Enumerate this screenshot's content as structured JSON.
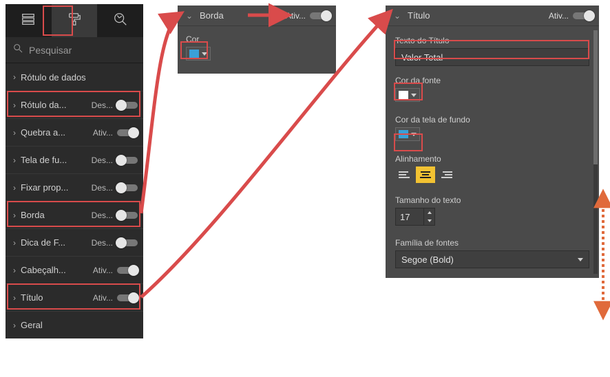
{
  "tabs": {
    "active": "format"
  },
  "search": {
    "placeholder": "Pesquisar"
  },
  "sidebar_items": [
    {
      "label": "Rótulo de dados",
      "state": "",
      "switch": null
    },
    {
      "label": "Rótulo da...",
      "state": "Des...",
      "switch": "off"
    },
    {
      "label": "Quebra a...",
      "state": "Ativ...",
      "switch": "on"
    },
    {
      "label": "Tela de fu...",
      "state": "Des...",
      "switch": "off"
    },
    {
      "label": "Fixar prop...",
      "state": "Des...",
      "switch": "off"
    },
    {
      "label": "Borda",
      "state": "Des...",
      "switch": "off"
    },
    {
      "label": "Dica de F...",
      "state": "Des...",
      "switch": "off"
    },
    {
      "label": "Cabeçalh...",
      "state": "Ativ...",
      "switch": "on"
    },
    {
      "label": "Título",
      "state": "Ativ...",
      "switch": "on"
    },
    {
      "label": "Geral",
      "state": "",
      "switch": null
    }
  ],
  "panel_borda": {
    "title": "Borda",
    "state": "Ativ...",
    "switch": "on",
    "prop_color_label": "Cor",
    "color": "#3aa0d8"
  },
  "panel_titulo": {
    "title": "Título",
    "state": "Ativ...",
    "switch": "on",
    "title_text_label": "Texto do Título",
    "title_text_value": "Valor Total",
    "font_color_label": "Cor da fonte",
    "font_color": "#ffffff",
    "bg_color_label": "Cor da tela de fundo",
    "bg_color": "#3aa0d8",
    "alignment_label": "Alinhamento",
    "alignment_selected": "center",
    "text_size_label": "Tamanho do texto",
    "text_size_value": "17",
    "font_family_label": "Família de fontes",
    "font_family_value": "Segoe (Bold)"
  },
  "colors": {
    "highlight": "#d94b4b",
    "arrow_red": "#d94b4b",
    "arrow_orange": "#e06a3b"
  }
}
